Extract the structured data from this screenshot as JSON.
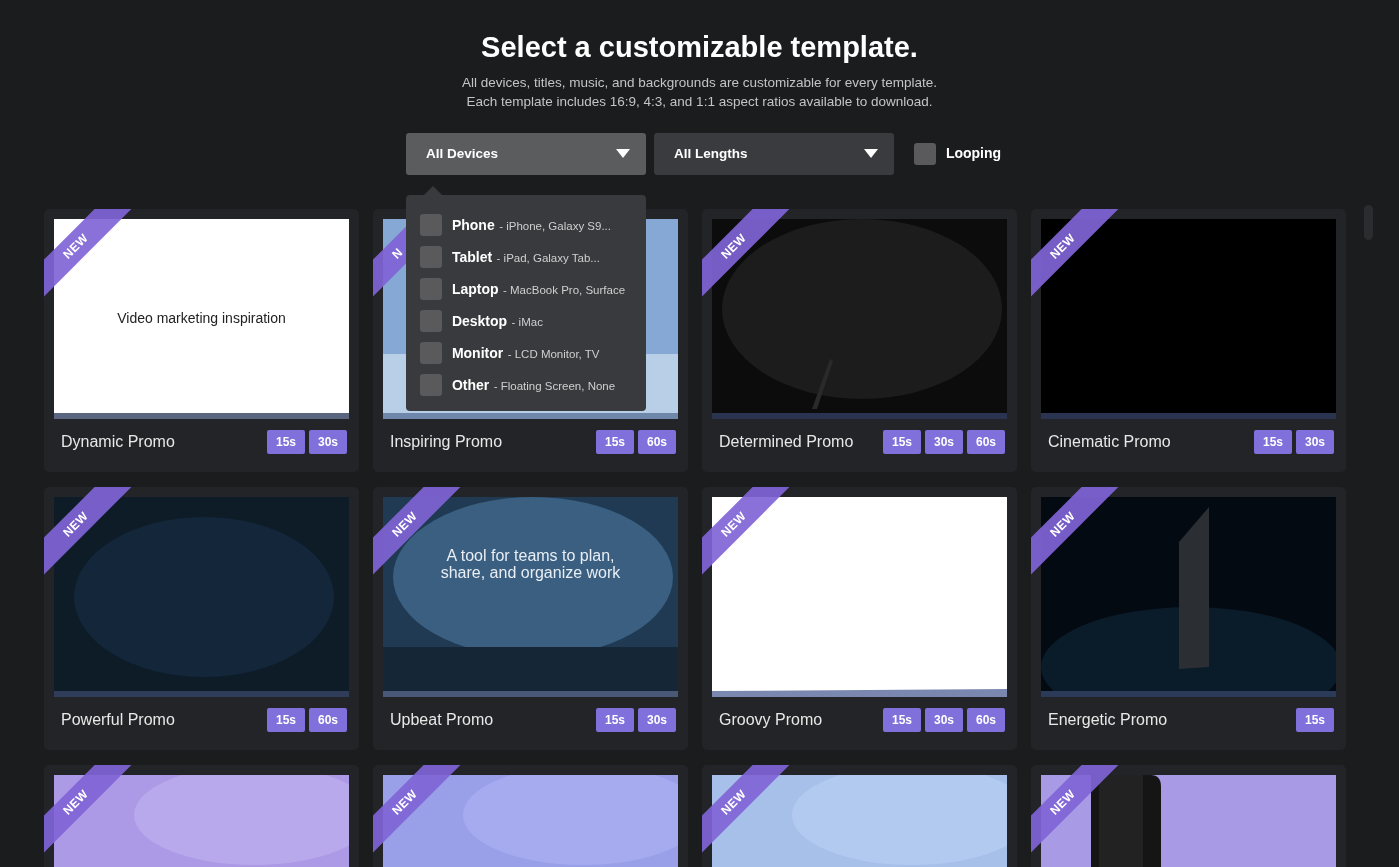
{
  "heading": "Select a customizable template.",
  "subtitle_lines": [
    "All devices, titles, music, and backgrounds are customizable for every template.",
    "Each template includes 16:9, 4:3, and 1:1 aspect ratios available to download."
  ],
  "filters": [
    {
      "label": "All Devices",
      "expanded": true,
      "options": [
        {
          "name": "Phone",
          "detail": "- iPhone, Galaxy S9...",
          "checked": false
        },
        {
          "name": "Tablet",
          "detail": "- iPad, Galaxy Tab...",
          "checked": false
        },
        {
          "name": "Laptop",
          "detail": "- MacBook Pro, Surface",
          "checked": false
        },
        {
          "name": "Desktop",
          "detail": "- iMac",
          "checked": false
        },
        {
          "name": "Monitor",
          "detail": "- LCD Monitor, TV",
          "checked": false
        },
        {
          "name": "Other",
          "detail": "- Floating Screen, None",
          "checked": false
        }
      ]
    },
    {
      "label": "All Lengths",
      "expanded": false
    }
  ],
  "looping": {
    "label": "Looping",
    "checked": false
  },
  "templates": [
    {
      "ribbon": "NEW",
      "thumbnail": {
        "kind": "picture",
        "caption": "Video marketing inspiration"
      },
      "title": "Dynamic Promo",
      "durations": [
        "15s",
        "30s"
      ]
    },
    {
      "ribbon": "N",
      "thumbnail": {
        "kind": "picture"
      },
      "title": "Inspiring Promo",
      "durations": [
        "15s",
        "60s"
      ]
    },
    {
      "ribbon": "NEW",
      "thumbnail": {
        "kind": "picture"
      },
      "title": "Determined Promo",
      "durations": [
        "15s",
        "30s",
        "60s"
      ]
    },
    {
      "ribbon": "NEW",
      "thumbnail": {
        "kind": "picture"
      },
      "title": "Cinematic Promo",
      "durations": [
        "15s",
        "30s"
      ]
    },
    {
      "ribbon": "NEW",
      "thumbnail": {
        "kind": "picture"
      },
      "title": "Powerful Promo",
      "durations": [
        "15s",
        "60s"
      ]
    },
    {
      "ribbon": "NEW",
      "thumbnail": {
        "kind": "picture",
        "caption": "A tool for teams to plan, share, and organize work"
      },
      "title": "Upbeat Promo",
      "durations": [
        "15s",
        "30s"
      ]
    },
    {
      "ribbon": "NEW",
      "thumbnail": {
        "kind": "picture"
      },
      "title": "Groovy Promo",
      "durations": [
        "15s",
        "30s",
        "60s"
      ]
    },
    {
      "ribbon": "NEW",
      "thumbnail": {
        "kind": "picture"
      },
      "title": "Energetic Promo",
      "durations": [
        "15s"
      ]
    },
    {
      "ribbon": "NEW",
      "thumbnail": {
        "kind": "picture"
      }
    },
    {
      "ribbon": "NEW",
      "thumbnail": {
        "kind": "picture"
      }
    },
    {
      "ribbon": "NEW",
      "thumbnail": {
        "kind": "picture"
      }
    },
    {
      "ribbon": "NEW",
      "thumbnail": {
        "kind": "picture"
      }
    }
  ]
}
